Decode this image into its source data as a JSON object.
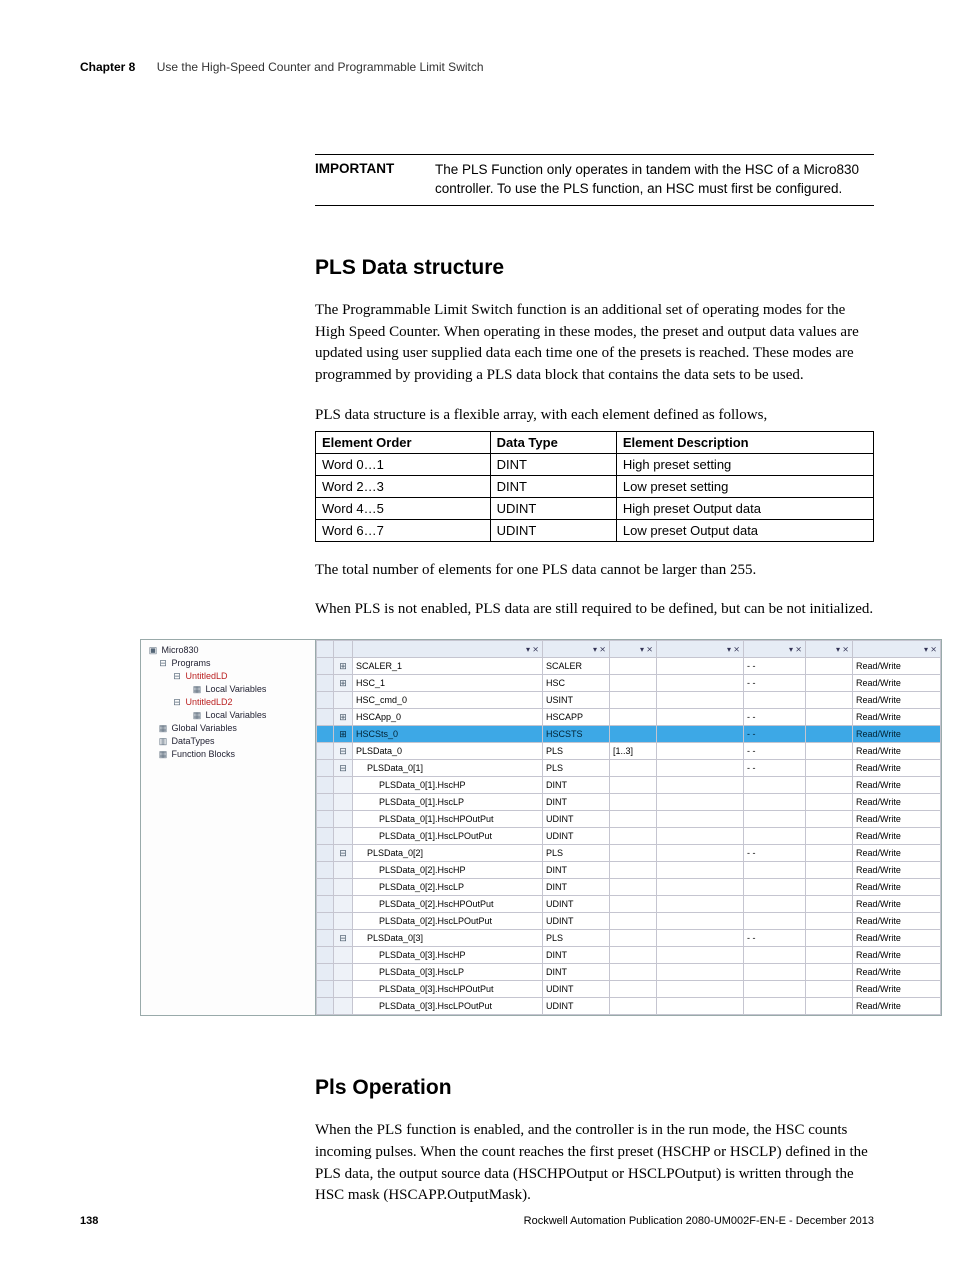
{
  "header": {
    "chapter_label": "Chapter 8",
    "chapter_title": "Use the High-Speed Counter and Programmable Limit Switch"
  },
  "important": {
    "label": "IMPORTANT",
    "text": "The PLS Function only operates in tandem with the HSC of a Micro830 controller. To use the PLS function, an HSC must first be configured."
  },
  "section1": {
    "heading": "PLS Data structure",
    "para1": "The Programmable Limit Switch function is an additional set of operating modes for the High Speed Counter. When operating in these modes, the preset and output data values are updated using user supplied data each time one of the presets is reached. These modes are programmed by providing a PLS data block that contains the data sets to be used.",
    "para2": "PLS data structure is a flexible array, with each element defined as follows,",
    "table": {
      "headers": [
        "Element Order",
        "Data Type",
        "Element Description"
      ],
      "rows": [
        [
          "Word 0…1",
          "DINT",
          "High preset setting"
        ],
        [
          "Word 2…3",
          "DINT",
          "Low preset setting"
        ],
        [
          "Word 4…5",
          "UDINT",
          "High preset Output data"
        ],
        [
          "Word 6…7",
          "UDINT",
          "Low preset Output data"
        ]
      ]
    },
    "para3": "The total number of elements for one PLS data cannot be larger than 255.",
    "para4": "When PLS is not enabled, PLS data are still required to be defined, but can be not initialized."
  },
  "screenshot": {
    "tree_root": "Micro830",
    "tree": [
      {
        "lvl": 1,
        "icon": "⊟",
        "label": "Programs"
      },
      {
        "lvl": 2,
        "icon": "⊟",
        "label": "UntitledLD",
        "cls": "red-folder"
      },
      {
        "lvl": 3,
        "icon": "▦",
        "label": "Local Variables"
      },
      {
        "lvl": 2,
        "icon": "⊟",
        "label": "UntitledLD2",
        "cls": "red-folder"
      },
      {
        "lvl": 3,
        "icon": "▦",
        "label": "Local Variables"
      },
      {
        "lvl": 1,
        "icon": "▦",
        "label": "Global Variables"
      },
      {
        "lvl": 1,
        "icon": "▥",
        "label": "DataTypes"
      },
      {
        "lvl": 1,
        "icon": "▦",
        "label": "Function Blocks"
      }
    ],
    "grid_header_icons": "▾ ⨯",
    "grid": [
      {
        "exp": "⊞",
        "name": "SCALER_1",
        "type": "SCALER",
        "dim": "",
        "c1": "",
        "c2": "- -",
        "c3": "",
        "acc": "Read/Write"
      },
      {
        "exp": "⊞",
        "name": "HSC_1",
        "type": "HSC",
        "dim": "",
        "c1": "",
        "c2": "- -",
        "c3": "",
        "acc": "Read/Write"
      },
      {
        "exp": "",
        "name": "HSC_cmd_0",
        "type": "USINT",
        "dim": "",
        "c1": "",
        "c2": "",
        "c3": "",
        "acc": "Read/Write"
      },
      {
        "exp": "⊞",
        "name": "HSCApp_0",
        "type": "HSCAPP",
        "dim": "",
        "c1": "",
        "c2": "- -",
        "c3": "",
        "acc": "Read/Write"
      },
      {
        "hl": true,
        "exp": "⊞",
        "name": "HSCSts_0",
        "type": "HSCSTS",
        "dim": "",
        "c1": "",
        "c2": "- -",
        "c3": "",
        "acc": "Read/Write"
      },
      {
        "exp": "⊟",
        "name": "PLSData_0",
        "type": "PLS",
        "dim": "[1..3]",
        "c1": "",
        "c2": "- -",
        "c3": "",
        "acc": "Read/Write"
      },
      {
        "exp": "⊟",
        "name": "PLSData_0[1]",
        "pad": 1,
        "type": "PLS",
        "dim": "",
        "c1": "",
        "c2": "- -",
        "c3": "",
        "acc": "Read/Write"
      },
      {
        "name": "PLSData_0[1].HscHP",
        "pad": 2,
        "type": "DINT",
        "acc": "Read/Write"
      },
      {
        "name": "PLSData_0[1].HscLP",
        "pad": 2,
        "type": "DINT",
        "acc": "Read/Write"
      },
      {
        "name": "PLSData_0[1].HscHPOutPut",
        "pad": 2,
        "type": "UDINT",
        "acc": "Read/Write"
      },
      {
        "name": "PLSData_0[1].HscLPOutPut",
        "pad": 2,
        "type": "UDINT",
        "acc": "Read/Write"
      },
      {
        "exp": "⊟",
        "name": "PLSData_0[2]",
        "pad": 1,
        "type": "PLS",
        "dim": "",
        "c1": "",
        "c2": "- -",
        "c3": "",
        "acc": "Read/Write"
      },
      {
        "name": "PLSData_0[2].HscHP",
        "pad": 2,
        "type": "DINT",
        "acc": "Read/Write"
      },
      {
        "name": "PLSData_0[2].HscLP",
        "pad": 2,
        "type": "DINT",
        "acc": "Read/Write"
      },
      {
        "name": "PLSData_0[2].HscHPOutPut",
        "pad": 2,
        "type": "UDINT",
        "acc": "Read/Write"
      },
      {
        "name": "PLSData_0[2].HscLPOutPut",
        "pad": 2,
        "type": "UDINT",
        "acc": "Read/Write"
      },
      {
        "exp": "⊟",
        "name": "PLSData_0[3]",
        "pad": 1,
        "type": "PLS",
        "dim": "",
        "c1": "",
        "c2": "- -",
        "c3": "",
        "acc": "Read/Write"
      },
      {
        "name": "PLSData_0[3].HscHP",
        "pad": 2,
        "type": "DINT",
        "acc": "Read/Write"
      },
      {
        "name": "PLSData_0[3].HscLP",
        "pad": 2,
        "type": "DINT",
        "acc": "Read/Write"
      },
      {
        "name": "PLSData_0[3].HscHPOutPut",
        "pad": 2,
        "type": "UDINT",
        "acc": "Read/Write"
      },
      {
        "name": "PLSData_0[3].HscLPOutPut",
        "pad": 2,
        "type": "UDINT",
        "acc": "Read/Write"
      }
    ]
  },
  "section2": {
    "heading": "Pls Operation",
    "para1": "When the PLS function is enabled, and the controller is in the run mode, the HSC counts incoming pulses. When the count reaches the first preset (HSCHP or HSCLP) defined in the PLS data, the output source data (HSCHPOutput or HSCLPOutput) is written through the HSC mask (HSCAPP.OutputMask)."
  },
  "footer": {
    "page": "138",
    "pub": "Rockwell Automation Publication 2080-UM002F-EN-E - December 2013"
  }
}
